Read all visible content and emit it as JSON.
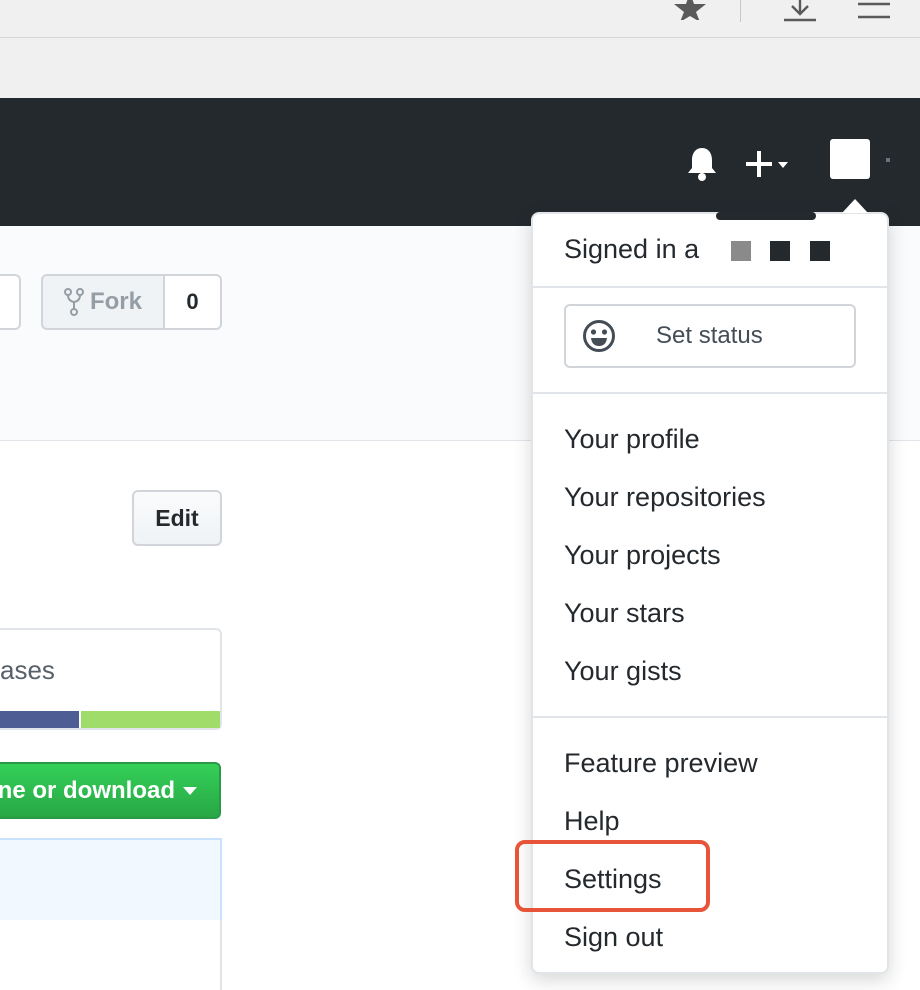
{
  "browser": {
    "toolbar_icons": [
      "star-icon",
      "download-icon",
      "menu-icon"
    ]
  },
  "header": {
    "icons": [
      "bell-icon",
      "plus-icon",
      "avatar"
    ],
    "plus_label": "+"
  },
  "repo": {
    "fork_label": "Fork",
    "fork_count": "0",
    "edit_label": "Edit",
    "languages_partial": "ases",
    "language_colors": [
      "#4F5D95",
      "#a0dc6a"
    ],
    "clone_label": "ne or download"
  },
  "dropdown": {
    "signed_in": "Signed in a",
    "redact_colors": [
      "#8a8a8a",
      "#24292e",
      "#24292e"
    ],
    "set_status": "Set status",
    "section1": [
      "Your profile",
      "Your repositories",
      "Your projects",
      "Your stars",
      "Your gists"
    ],
    "section2": [
      "Feature preview",
      "Help",
      "Settings",
      "Sign out"
    ],
    "highlighted_item": "Settings",
    "highlight_color": "#e8543a"
  }
}
